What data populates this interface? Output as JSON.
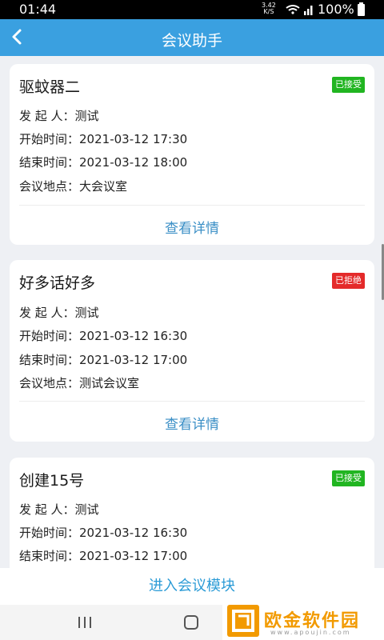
{
  "status": {
    "time": "01:44",
    "net_speed_top": "3.42",
    "net_speed_bottom": "K/S",
    "battery": "100%"
  },
  "header": {
    "title": "会议助手"
  },
  "labels": {
    "initiator": "发 起 人：",
    "start": "开始时间：",
    "end": "结束时间：",
    "location": "会议地点：",
    "detail": "查看详情"
  },
  "meetings": [
    {
      "title": "驱蚊器二",
      "status": "已接受",
      "status_type": "accepted",
      "initiator": "测试",
      "start": "2021-03-12 17:30",
      "end": "2021-03-12 18:00",
      "location": "大会议室"
    },
    {
      "title": "好多话好多",
      "status": "已拒绝",
      "status_type": "rejected",
      "initiator": "测试",
      "start": "2021-03-12 16:30",
      "end": "2021-03-12 17:00",
      "location": "测试会议室"
    },
    {
      "title": "创建15号",
      "status": "已接受",
      "status_type": "accepted",
      "initiator": "测试",
      "start": "2021-03-12 16:30",
      "end": "2021-03-12 17:00"
    }
  ],
  "footer": {
    "enter_button": "进入会议模块"
  },
  "watermark": {
    "brand": "欧金软件园",
    "url": "www.apoujin.com"
  },
  "colors": {
    "primary": "#3aa0e0",
    "accepted": "#21b521",
    "rejected": "#e42a2a",
    "link": "#3b8fc6"
  }
}
